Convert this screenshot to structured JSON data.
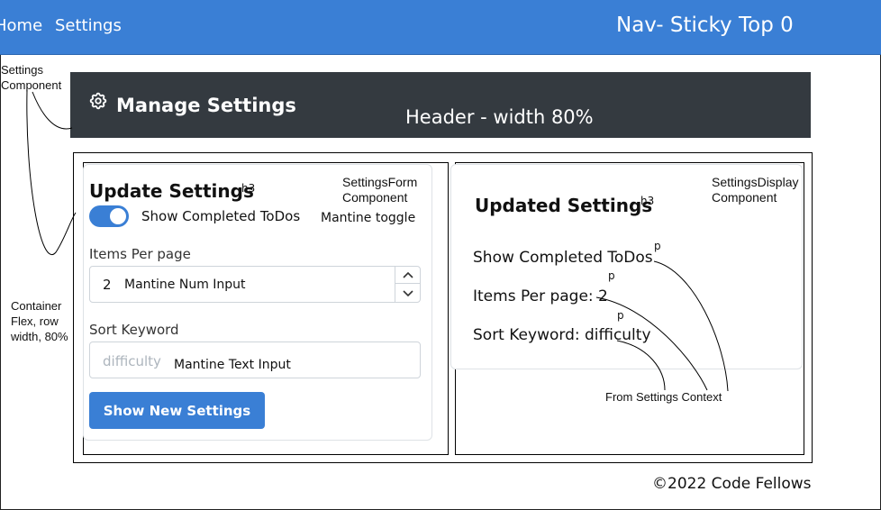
{
  "nav": {
    "links": [
      "Home",
      "Settings"
    ],
    "note": "Nav- Sticky Top 0"
  },
  "header": {
    "title": "Manage Settings",
    "note": "Header - width 80%",
    "icon": "gear-icon"
  },
  "annotations": {
    "settings_component": "Settings Component",
    "container": "Container Flex, row width, 80%",
    "from_context": "From Settings Context"
  },
  "form": {
    "title": "Update Settings",
    "title_tag": "h3",
    "component_note": "SettingsForm Component",
    "toggle_label": "Show Completed ToDos",
    "toggle_checked": true,
    "toggle_note": "Mantine toggle",
    "items_label": "Items Per page",
    "items_value": "2",
    "num_input_note": "Mantine Num Input",
    "sort_label": "Sort Keyword",
    "sort_placeholder": "difficulty",
    "text_input_note": "Mantine Text Input",
    "button_label": "Show New Settings"
  },
  "display": {
    "title": "Updated Settings",
    "title_tag": "h3",
    "component_note": "SettingsDisplay Component",
    "p_tag": "p",
    "lines": [
      "Show Completed ToDos",
      "Items Per page: 2",
      "Sort Keyword: difficulty"
    ]
  },
  "footer": {
    "text": "©2022 Code Fellows"
  },
  "colors": {
    "nav": "#3a7fd5",
    "header": "#343a40",
    "accent": "#3a7fd5"
  }
}
